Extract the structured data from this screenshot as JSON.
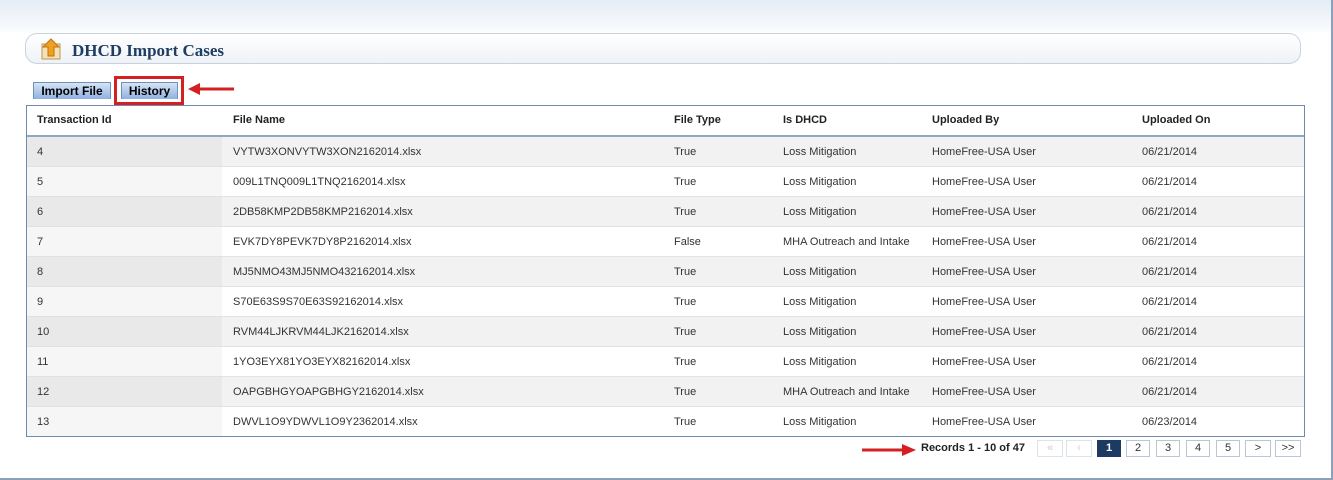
{
  "page": {
    "title": "DHCD Import Cases"
  },
  "tabs": [
    {
      "label": "Import File",
      "selected": false
    },
    {
      "label": "History",
      "selected": true
    }
  ],
  "icons": {
    "title_icon": "upload-house-icon",
    "annotation": "red-arrow-icon"
  },
  "colors": {
    "accent": "#1f3d63",
    "annotation_red": "#d42020",
    "active_page": "#1d3a63"
  },
  "grid": {
    "columns": [
      "Transaction Id",
      "File Name",
      "File Type",
      "Is DHCD",
      "Uploaded By",
      "Uploaded On"
    ],
    "rows": [
      [
        "4",
        "VYTW3XONVYTW3XON2162014.xlsx",
        "True",
        "Loss Mitigation",
        "HomeFree-USA User",
        "06/21/2014"
      ],
      [
        "5",
        "009L1TNQ009L1TNQ2162014.xlsx",
        "True",
        "Loss Mitigation",
        "HomeFree-USA User",
        "06/21/2014"
      ],
      [
        "6",
        "2DB58KMP2DB58KMP2162014.xlsx",
        "True",
        "Loss Mitigation",
        "HomeFree-USA User",
        "06/21/2014"
      ],
      [
        "7",
        "EVK7DY8PEVK7DY8P2162014.xlsx",
        "False",
        "MHA Outreach and Intake",
        "HomeFree-USA User",
        "06/21/2014"
      ],
      [
        "8",
        "MJ5NMO43MJ5NMO432162014.xlsx",
        "True",
        "Loss Mitigation",
        "HomeFree-USA User",
        "06/21/2014"
      ],
      [
        "9",
        "S70E63S9S70E63S92162014.xlsx",
        "True",
        "Loss Mitigation",
        "HomeFree-USA User",
        "06/21/2014"
      ],
      [
        "10",
        "RVM44LJKRVM44LJK2162014.xlsx",
        "True",
        "Loss Mitigation",
        "HomeFree-USA User",
        "06/21/2014"
      ],
      [
        "11",
        "1YO3EYX81YO3EYX82162014.xlsx",
        "True",
        "Loss Mitigation",
        "HomeFree-USA User",
        "06/21/2014"
      ],
      [
        "12",
        "OAPGBHGYOAPGBHGY2162014.xlsx",
        "True",
        "MHA Outreach and Intake",
        "HomeFree-USA User",
        "06/21/2014"
      ],
      [
        "13",
        "DWVL1O9YDWVL1O9Y2362014.xlsx",
        "True",
        "Loss Mitigation",
        "HomeFree-USA User",
        "06/23/2014"
      ]
    ]
  },
  "pager": {
    "records_text": "Records 1 - 10 of 47",
    "first": "«",
    "prev": "‹",
    "pages": [
      "1",
      "2",
      "3",
      "4",
      "5"
    ],
    "current": "1",
    "next": ">",
    "last": ">>"
  }
}
